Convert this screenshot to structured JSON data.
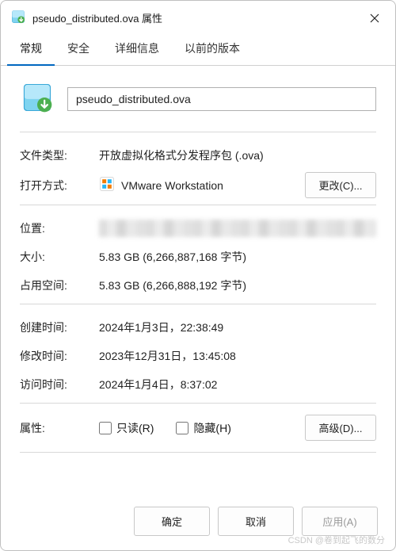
{
  "window": {
    "title": "pseudo_distributed.ova 属性"
  },
  "tabs": {
    "general": "常规",
    "security": "安全",
    "details": "详细信息",
    "previous": "以前的版本"
  },
  "filename": "pseudo_distributed.ova",
  "labels": {
    "fileType": "文件类型:",
    "opensWith": "打开方式:",
    "location": "位置:",
    "size": "大小:",
    "sizeOnDisk": "占用空间:",
    "created": "创建时间:",
    "modified": "修改时间:",
    "accessed": "访问时间:",
    "attributes": "属性:"
  },
  "values": {
    "fileType": "开放虚拟化格式分发程序包 (.ova)",
    "opensWith": "VMware Workstation",
    "size": "5.83 GB (6,266,887,168 字节)",
    "sizeOnDisk": "5.83 GB (6,266,888,192 字节)",
    "created": "2024年1月3日，22:38:49",
    "modified": "2023年12月31日，13:45:08",
    "accessed": "2024年1月4日，8:37:02"
  },
  "buttons": {
    "change": "更改(C)...",
    "advanced": "高级(D)...",
    "ok": "确定",
    "cancel": "取消",
    "apply": "应用(A)"
  },
  "checkboxes": {
    "readonly": "只读(R)",
    "hidden": "隐藏(H)"
  },
  "watermark": "CSDN @卷到起飞的数分"
}
